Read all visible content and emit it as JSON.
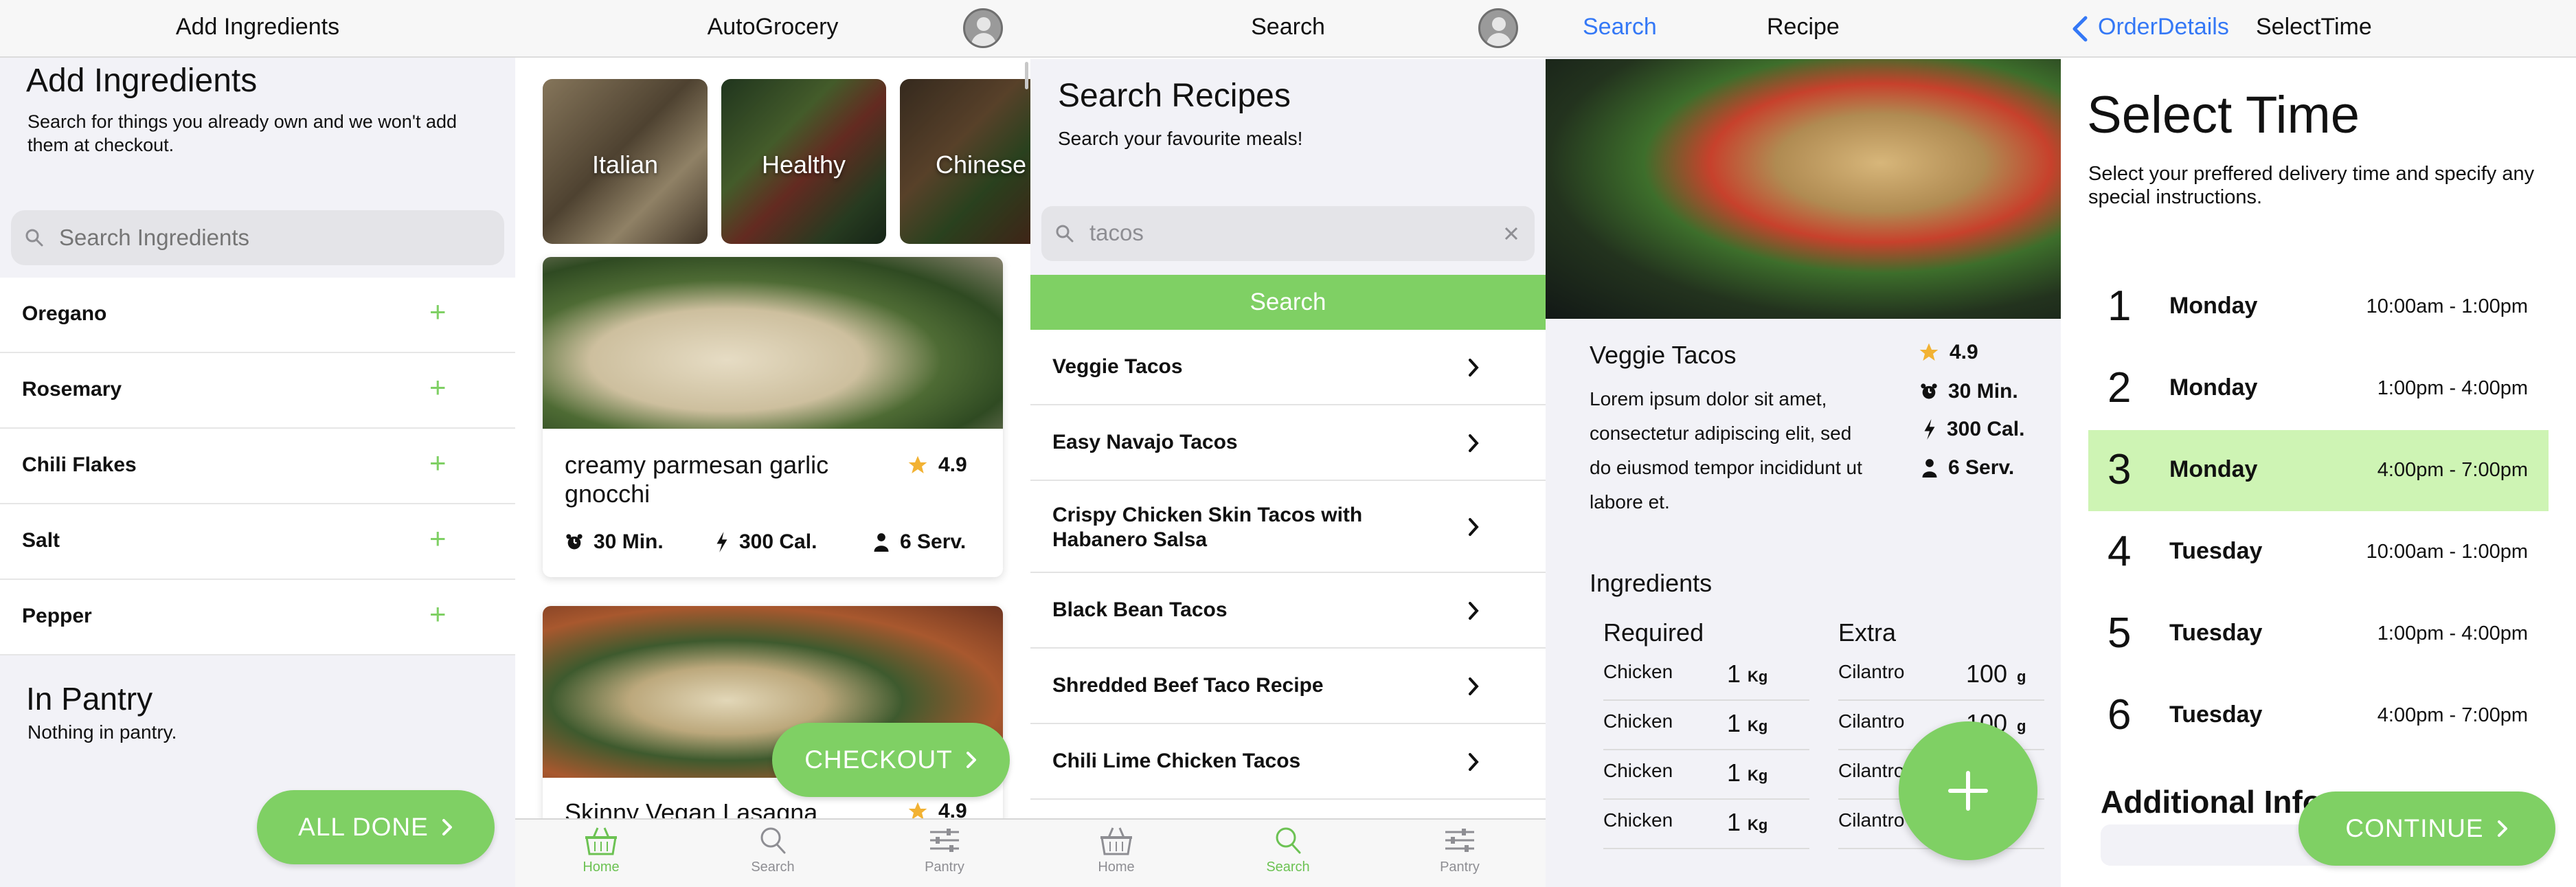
{
  "colors": {
    "accent_green": "#7fd064",
    "highlight_green": "#cef4b4",
    "ios_blue": "#3478f6",
    "star": "#f2b233"
  },
  "screen1": {
    "nav_title": "Add Ingredients",
    "heading": "Add Ingredients",
    "subtitle": "Search for things you already own and we won't add them at checkout.",
    "search_placeholder": "Search Ingredients",
    "items": [
      {
        "label": "Oregano",
        "action_icon": "plus-icon"
      },
      {
        "label": "Rosemary",
        "action_icon": "plus-icon"
      },
      {
        "label": "Chili Flakes",
        "action_icon": "plus-icon"
      },
      {
        "label": "Salt",
        "action_icon": "plus-icon"
      },
      {
        "label": "Pepper",
        "action_icon": "plus-icon"
      }
    ],
    "pantry_title": "In Pantry",
    "pantry_empty": "Nothing in pantry.",
    "done_button": "ALL DONE"
  },
  "screen2": {
    "nav_title": "AutoGrocery",
    "categories": [
      "Italian",
      "Healthy",
      "Chinese"
    ],
    "recipes": [
      {
        "title": "creamy parmesan garlic gnocchi",
        "rating": "4.9",
        "time": "30 Min.",
        "calories": "300 Cal.",
        "servings": "6 Serv."
      },
      {
        "title": "Skinny Vegan Lasagna",
        "rating": "4.9"
      }
    ],
    "checkout_button": "CHECKOUT",
    "tabs": [
      "Home",
      "Search",
      "Pantry"
    ],
    "active_tab": "Home"
  },
  "screen3": {
    "nav_title": "Search",
    "heading": "Search Recipes",
    "subtitle": "Search your favourite meals!",
    "search_value": "tacos",
    "search_button": "Search",
    "results": [
      "Veggie Tacos",
      "Easy Navajo Tacos",
      "Crispy Chicken Skin Tacos with Habanero Salsa",
      "Black Bean Tacos",
      "Shredded Beef Taco Recipe",
      "Chili Lime Chicken Tacos"
    ],
    "tabs": [
      "Home",
      "Search",
      "Pantry"
    ],
    "active_tab": "Search"
  },
  "screen4": {
    "back_label": "Search",
    "nav_title": "Recipe",
    "recipe_title": "Veggie Tacos",
    "description": "Lorem ipsum dolor sit amet, consectetur adipiscing elit, sed do eiusmod tempor incididunt ut labore et.",
    "rating": "4.9",
    "time": "30 Min.",
    "calories": "300 Cal.",
    "servings": "6 Serv.",
    "ingredients_title": "Ingredients",
    "required_header": "Required",
    "extra_header": "Extra",
    "required": [
      {
        "name": "Chicken",
        "qty": "1",
        "unit": "Kg"
      },
      {
        "name": "Chicken",
        "qty": "1",
        "unit": "Kg"
      },
      {
        "name": "Chicken",
        "qty": "1",
        "unit": "Kg"
      },
      {
        "name": "Chicken",
        "qty": "1",
        "unit": "Kg"
      }
    ],
    "extra": [
      {
        "name": "Cilantro",
        "qty": "100",
        "unit": "g"
      },
      {
        "name": "Cilantro",
        "qty": "100",
        "unit": "g"
      },
      {
        "name": "Cilantro",
        "qty": "",
        "unit": ""
      },
      {
        "name": "Cilantro",
        "qty": "",
        "unit": ""
      }
    ],
    "fab_icon": "plus-icon"
  },
  "screen5": {
    "back_label": "OrderDetails",
    "nav_title": "SelectTime",
    "heading": "Select Time",
    "subtitle": "Select your preffered delivery time and specify any special instructions.",
    "slots": [
      {
        "num": "1",
        "day": "Monday",
        "time": "10:00am - 1:00pm",
        "selected": false
      },
      {
        "num": "2",
        "day": "Monday",
        "time": "1:00pm - 4:00pm",
        "selected": false
      },
      {
        "num": "3",
        "day": "Monday",
        "time": "4:00pm - 7:00pm",
        "selected": true
      },
      {
        "num": "4",
        "day": "Tuesday",
        "time": "10:00am - 1:00pm",
        "selected": false
      },
      {
        "num": "5",
        "day": "Tuesday",
        "time": "1:00pm - 4:00pm",
        "selected": false
      },
      {
        "num": "6",
        "day": "Tuesday",
        "time": "4:00pm - 7:00pm",
        "selected": false
      }
    ],
    "additional_title": "Additional Info",
    "continue_button": "CONTINUE"
  }
}
